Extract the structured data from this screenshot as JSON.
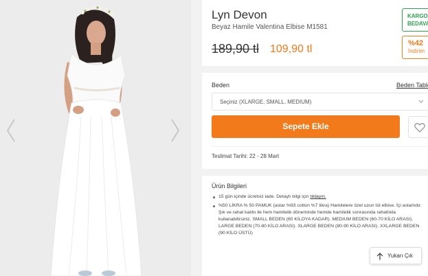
{
  "gallery": {
    "image_alt": "model-in-white-maternity-dress",
    "prev_icon": "chevron-left-icon",
    "next_icon": "chevron-right-icon"
  },
  "product": {
    "brand": "Lyn Devon",
    "name": "Beyaz Hamile Valentina Elbise M1581",
    "old_price": "189,90 tl",
    "new_price": "109,90 tl",
    "badges": {
      "cargo": "KARGO BEDAVA",
      "discount_pct": "%42",
      "discount_label": "İndirim"
    }
  },
  "size": {
    "label": "Beden",
    "table_link": "Beden Tablosu",
    "select_value": "Seçiniz (XLARGE, SMALL, MEDIUM)",
    "add_to_cart": "Sepete Ekle",
    "delivery": "Teslimat Tarihi: 22 - 28 Mart"
  },
  "info": {
    "title": "Ürün Bilgileri",
    "item1_text": "15 gün içinde ücretsiz iade. Detaylı bilgi için",
    "item1_link": "tıklayın.",
    "item2_text": "%50 LİKRA % 50 PAMUK (astar %93 cotton %7 likra) Hamilelere özel uzun tül elbise. İçi astarlıdır. Şık ve rahat kalıbı ile hem hamilelik döneminde hemde hamilelik sonrasında rahatlıkla kullanabilirsiniz. SMALL BEDEN (60 KİLOYA KADAR). MEDIUM BEDEN (60-70 KİLO ARASI). LARGE BEDEN (70-80 KİLO ARASI). XLARGE BEDEN (80-90 KİLO ARASI). XXLARGE BEDEN (90 KİLO ÜSTÜ)"
  },
  "back_to_top": "Yukarı Çık",
  "colors": {
    "accent": "#f27a1a",
    "cargo_green": "#2aa44f"
  }
}
